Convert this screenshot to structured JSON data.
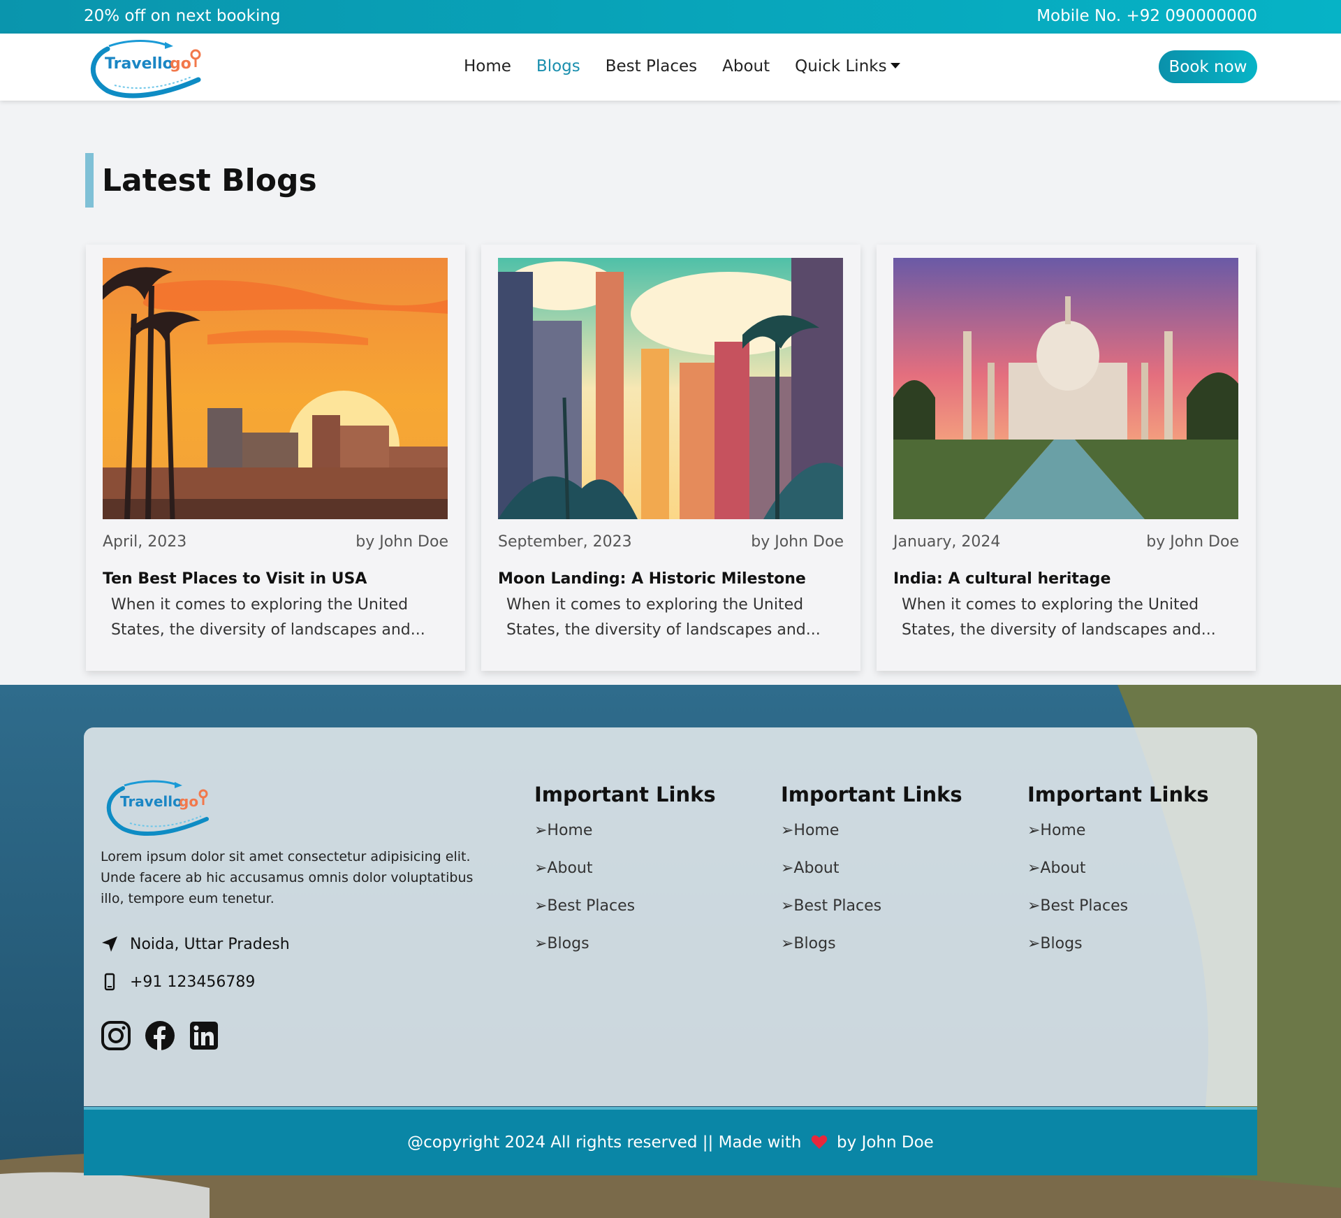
{
  "topbar": {
    "promo": "20% off on next booking",
    "phone": "Mobile No. +92 090000000"
  },
  "brand": {
    "logo_text_main": "Travello",
    "logo_text_accent": "go!",
    "colors": {
      "primary": "#0a91ab",
      "accent_orange": "#f2784b",
      "logo_blue": "#1a86c4"
    }
  },
  "nav": {
    "items": [
      {
        "label": "Home",
        "active": false
      },
      {
        "label": "Blogs",
        "active": true
      },
      {
        "label": "Best Places",
        "active": false
      },
      {
        "label": "About",
        "active": false
      },
      {
        "label": "Quick Links",
        "active": false
      }
    ],
    "book_button": "Book now"
  },
  "blogs": {
    "heading": "Latest Blogs",
    "cards": [
      {
        "date": "April, 2023",
        "author": "by John Doe",
        "title": "Ten Best Places to Visit in USA",
        "excerpt": "When it comes to exploring the United States, the diversity of landscapes and..."
      },
      {
        "date": "September, 2023",
        "author": "by John Doe",
        "title": "Moon Landing: A Historic Milestone",
        "excerpt": "When it comes to exploring the United States, the diversity of landscapes and..."
      },
      {
        "date": "January, 2024",
        "author": "by John Doe",
        "title": "India: A cultural heritage",
        "excerpt": "When it comes to exploring the United States, the diversity of landscapes and..."
      }
    ]
  },
  "footer": {
    "description": "Lorem ipsum dolor sit amet consectetur adipisicing elit. Unde facere ab hic accusamus omnis dolor voluptatibus illo, tempore eum tenetur.",
    "address": "Noida, Uttar Pradesh",
    "phone": "+91 123456789",
    "social_icons": [
      "instagram-icon",
      "facebook-icon",
      "linkedin-icon"
    ],
    "columns": [
      {
        "heading": "Important Links",
        "links": [
          "➢Home",
          "➢About",
          "➢Best Places",
          "➢Blogs"
        ]
      },
      {
        "heading": "Important Links",
        "links": [
          "➢Home",
          "➢About",
          "➢Best Places",
          "➢Blogs"
        ]
      },
      {
        "heading": "Important Links",
        "links": [
          "➢Home",
          "➢About",
          "➢Best Places",
          "➢Blogs"
        ]
      }
    ],
    "copyright_pre": "@copyright 2024 All rights reserved || Made with",
    "copyright_post": "by John Doe"
  }
}
